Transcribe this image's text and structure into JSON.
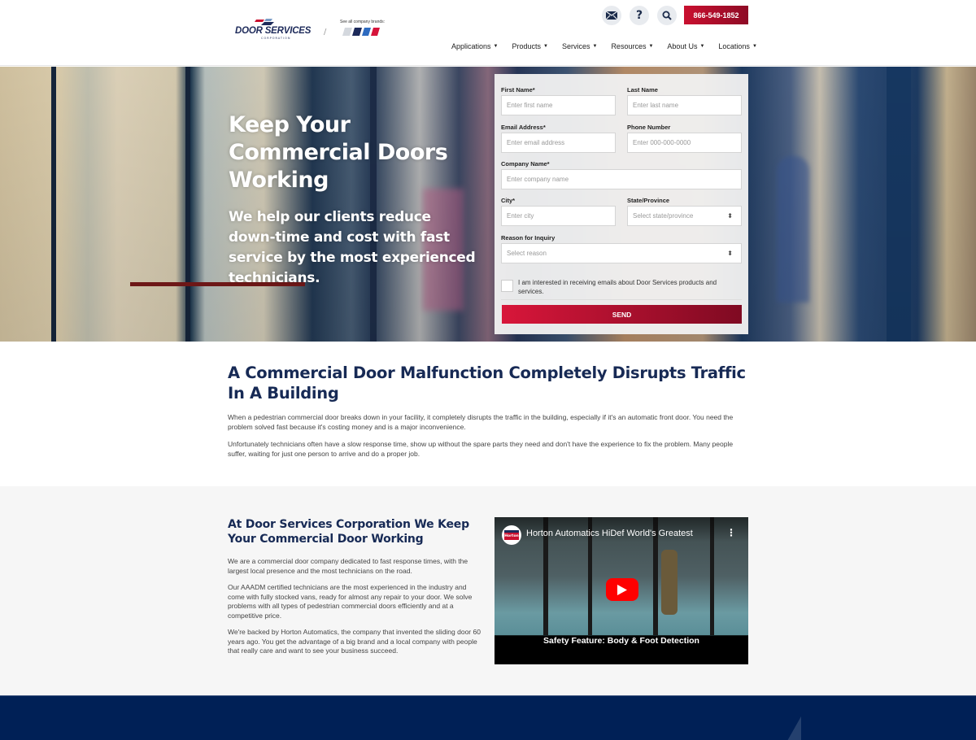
{
  "header": {
    "logo": {
      "name": "DOOR SERVICES",
      "sub": "CORPORATION"
    },
    "brands_label": "See all company brands:",
    "icons": [
      "envelope-icon",
      "question-icon",
      "search-icon"
    ],
    "phone": "866-549-1852",
    "nav": [
      {
        "label": "Applications"
      },
      {
        "label": "Products"
      },
      {
        "label": "Services"
      },
      {
        "label": "Resources"
      },
      {
        "label": "About Us"
      },
      {
        "label": "Locations"
      }
    ],
    "caret": "▼"
  },
  "hero": {
    "title": "Keep Your Commercial Doors Working",
    "subtitle": "We help our clients reduce down-time and cost with fast service by the most experienced technicians."
  },
  "form": {
    "first_name": {
      "label": "First Name*",
      "placeholder": "Enter first name"
    },
    "last_name": {
      "label": "Last Name",
      "placeholder": "Enter last name"
    },
    "email": {
      "label": "Email Address*",
      "placeholder": "Enter email address"
    },
    "phone": {
      "label": "Phone Number",
      "placeholder": "Enter 000-000-0000"
    },
    "company": {
      "label": "Company Name*",
      "placeholder": "Enter company name"
    },
    "city": {
      "label": "City*",
      "placeholder": "Enter city"
    },
    "state": {
      "label": "State/Province",
      "selected": "Select state/province"
    },
    "reason": {
      "label": "Reason for Inquiry",
      "selected": "Select reason"
    },
    "optin": {
      "label": "I am interested in receiving emails about Door Services products and services.",
      "checked": false
    },
    "submit": "SEND",
    "updown": "⬍"
  },
  "section2": {
    "title": "A Commercial Door Malfunction Completely Disrupts Traffic In A Building",
    "paragraphs": [
      "When a pedestrian commercial door breaks down in your facility, it completely disrupts the traffic in the building, especially if it's an automatic front door. You need the problem solved fast because it's costing money and is a major inconvenience.",
      "Unfortunately technicians often have a slow response time, show up without the spare parts they need and don't have the experience to fix the problem. Many people suffer, waiting for just one person to arrive and do a proper job."
    ]
  },
  "section3": {
    "title": "At Door Services Corporation We Keep Your Commercial Door Working",
    "paragraphs": [
      "We are a commercial door company dedicated to fast response times, with the largest local presence and the most technicians on the road.",
      "Our AAADM certified technicians are the most experienced in the industry and come with fully stocked vans, ready for almost any repair to your door. We solve problems with all types of pedestrian commercial doors efficiently and at a competitive price.",
      "We're backed by Horton Automatics, the company that invented the sliding door 60 years ago. You get the advantage of a big brand and a local company with people that really care and want to see your business succeed."
    ],
    "video": {
      "channel_badge": "Horton",
      "title": "Horton Automatics HiDef World's Greatest",
      "caption": "Safety Feature:  Body & Foot Detection",
      "menu": "⋮"
    }
  },
  "colors": {
    "navy": "#172a55",
    "brand_red": "#c9102f",
    "footer": "#002056"
  }
}
